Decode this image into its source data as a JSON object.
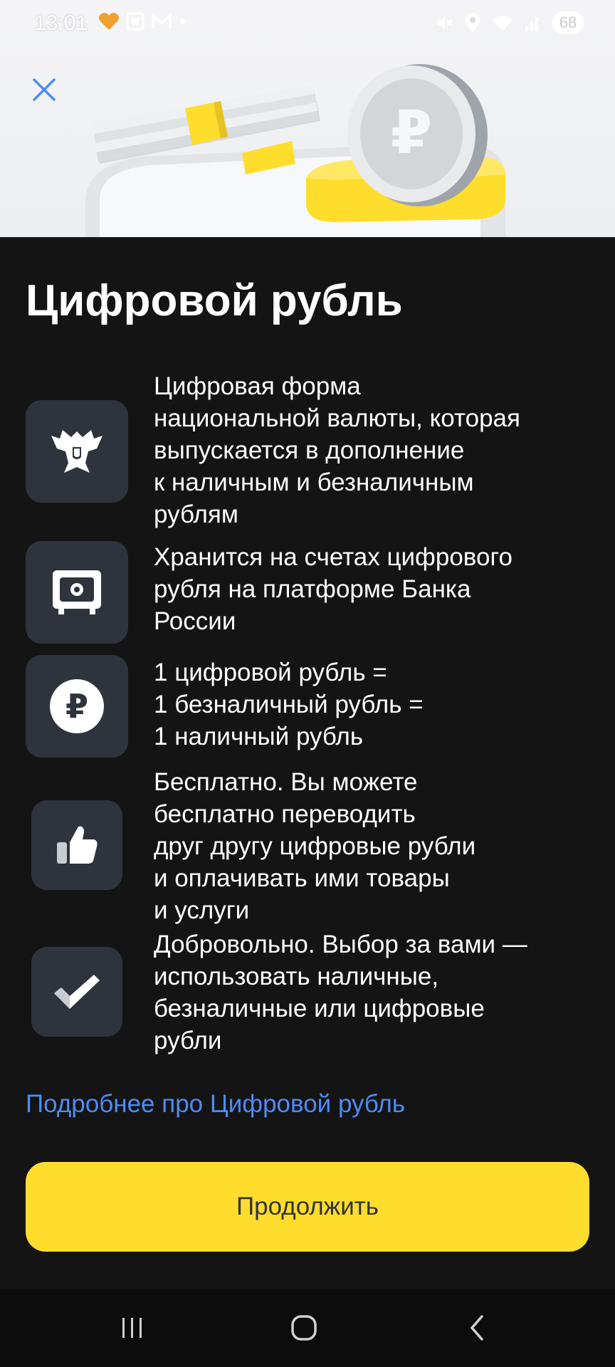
{
  "status_bar": {
    "time": "13:01",
    "battery": "68",
    "left_icons": [
      "heart-app-icon",
      "scan-icon",
      "gmail-icon",
      "dot-icon"
    ],
    "right_icons": [
      "mute-icon",
      "location-icon",
      "wifi-icon",
      "signal-icon"
    ]
  },
  "header": {
    "close_icon": "close-icon"
  },
  "title": "Цифровой рубль",
  "features": [
    {
      "icon": "eagle-emblem-icon",
      "text": "Цифровая форма\nнациональной валюты, которая\nвыпускается в дополнение\nк наличным и безналичным\nрублям"
    },
    {
      "icon": "safe-icon",
      "text": "Хранится на счетах цифрового\nрубля на платформе Банка\nРоссии"
    },
    {
      "icon": "ruble-coin-icon",
      "text": "1 цифровой рубль =\n1 безналичный рубль =\n1 наличный рубль"
    },
    {
      "icon": "thumbs-up-icon",
      "text": "Бесплатно. Вы можете\nбесплатно переводить\nдруг другу цифровые рубли\nи оплачивать ими товары\nи услуги"
    },
    {
      "icon": "checkmark-icon",
      "text": "Добровольно. Выбор за вами —\nиспользовать наличные,\nбезналичные или цифровые\nрубли"
    }
  ],
  "more_link": "Подробнее про Цифровой рубль",
  "continue_button": "Продолжить",
  "nav_bar": {
    "icons": [
      "recent-apps-icon",
      "home-icon",
      "back-icon"
    ]
  },
  "colors": {
    "background": "#141414",
    "icon_tile": "#2f333b",
    "link": "#4d8cf5",
    "button": "#ffdd2d",
    "button_text": "#333333",
    "close_icon": "#4d8cf5"
  }
}
